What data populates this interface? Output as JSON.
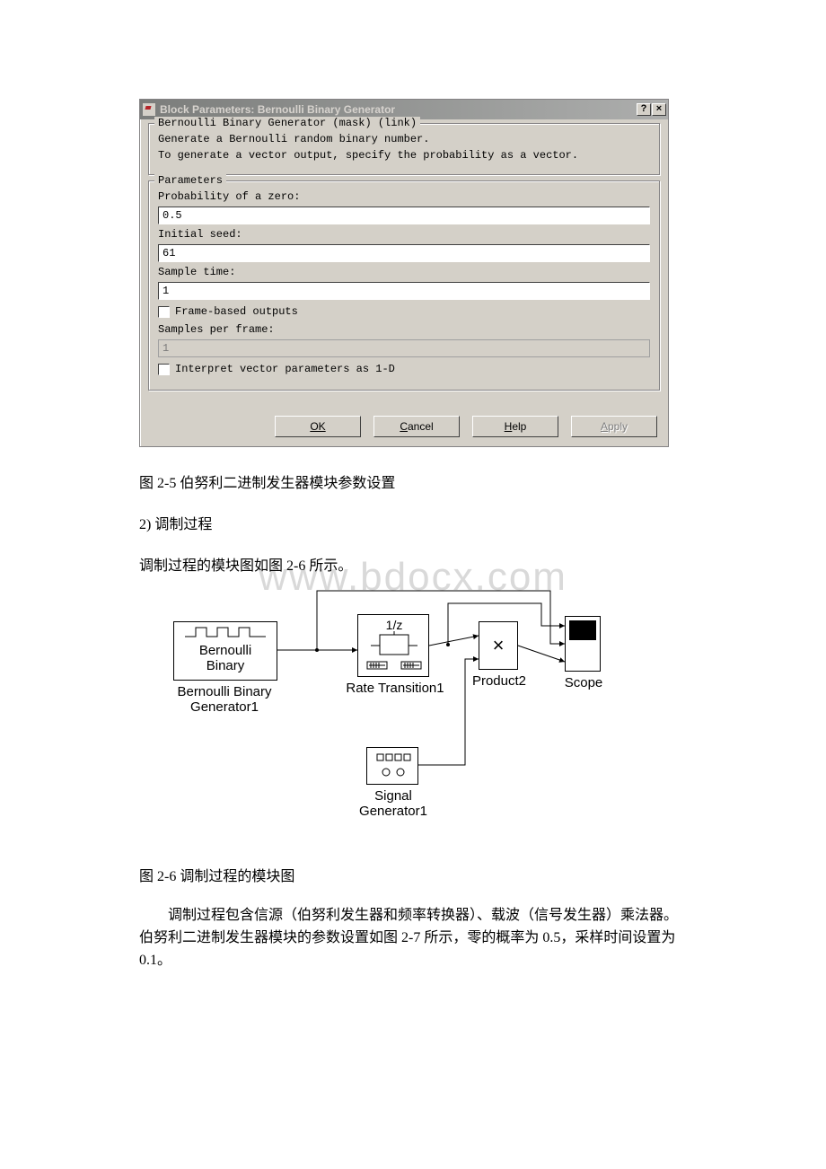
{
  "dialog": {
    "title": "Block Parameters: Bernoulli Binary Generator",
    "group1_legend": "Bernoulli Binary Generator (mask) (link)",
    "desc_line1": "Generate a Bernoulli random binary number.",
    "desc_line2": "To generate a vector output, specify the probability as a vector.",
    "group2_legend": "Parameters",
    "labels": {
      "prob_zero": "Probability of a zero:",
      "initial_seed": "Initial seed:",
      "sample_time": "Sample time:",
      "frame_out": "Frame-based outputs",
      "samples_per_frame": "Samples per frame:",
      "interpret_vec": "Interpret vector parameters as 1-D"
    },
    "values": {
      "prob_zero": "0.5",
      "initial_seed": "61",
      "sample_time": "1",
      "samples_per_frame": "1"
    },
    "buttons": {
      "ok": "OK",
      "cancel": "Cancel",
      "help": "Help",
      "apply": "Apply"
    }
  },
  "texts": {
    "caption1": "图 2-5 伯努利二进制发生器模块参数设置",
    "section2": "2) 调制过程",
    "line_diagram_intro": "调制过程的模块图如图 2-6 所示。",
    "caption2": "图 2-6 调制过程的模块图",
    "body": "调制过程包含信源（伯努利发生器和频率转换器）、载波（信号发生器）乘法器。伯努利二进制发生器模块的参数设置如图 2-7 所示，零的概率为 0.5，采样时间设置为 0.1。"
  },
  "watermark": "www.bdocx.com",
  "diagram": {
    "block1": {
      "l1": "Bernoulli",
      "l2": "Binary",
      "under1": "Bernoulli Binary",
      "under2": "Generator1"
    },
    "block2": {
      "top": "1/z",
      "under": "Rate Transition1"
    },
    "block3": {
      "sym": "×",
      "under": "Product2"
    },
    "block4": {
      "under": "Scope"
    },
    "block5": {
      "l1": "□□□□",
      "l2": "○ ○",
      "under1": "Signal",
      "under2": "Generator1"
    }
  }
}
